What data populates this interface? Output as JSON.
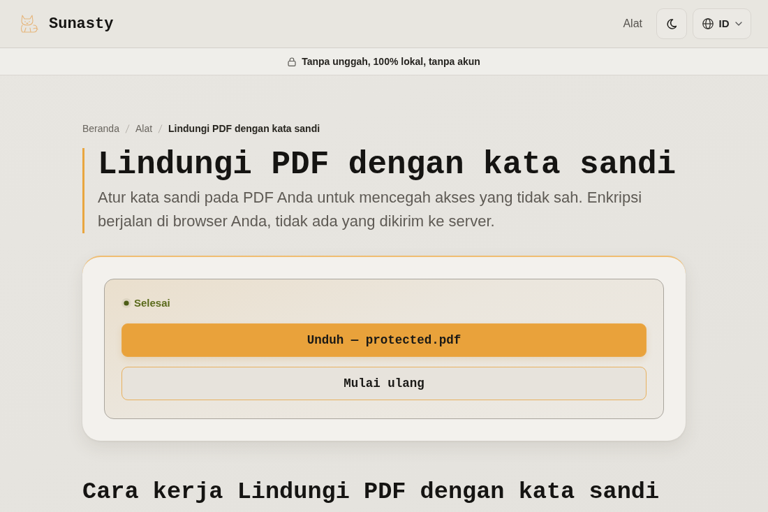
{
  "header": {
    "brand": "Sunasty",
    "nav_link": "Alat",
    "language": "ID"
  },
  "notice": "Tanpa unggah, 100% lokal, tanpa akun",
  "breadcrumb": [
    {
      "label": "Beranda",
      "current": false
    },
    {
      "label": "Alat",
      "current": false
    },
    {
      "label": "Lindungi PDF dengan kata sandi",
      "current": true
    }
  ],
  "title": "Lindungi PDF dengan kata sandi",
  "description": "Atur kata sandi pada PDF Anda untuk mencegah akses yang tidak sah. Enkripsi berjalan di browser Anda, tidak ada yang dikirim ke server.",
  "result": {
    "status": {
      "label": "Selesai",
      "done": true
    },
    "buttons": [
      {
        "label": "Unduh — protected.pdf",
        "kind": "primary"
      },
      {
        "label": "Mulai ulang",
        "kind": "outline"
      }
    ]
  },
  "section_heading": "Cara kerja Lindungi PDF dengan kata sandi"
}
